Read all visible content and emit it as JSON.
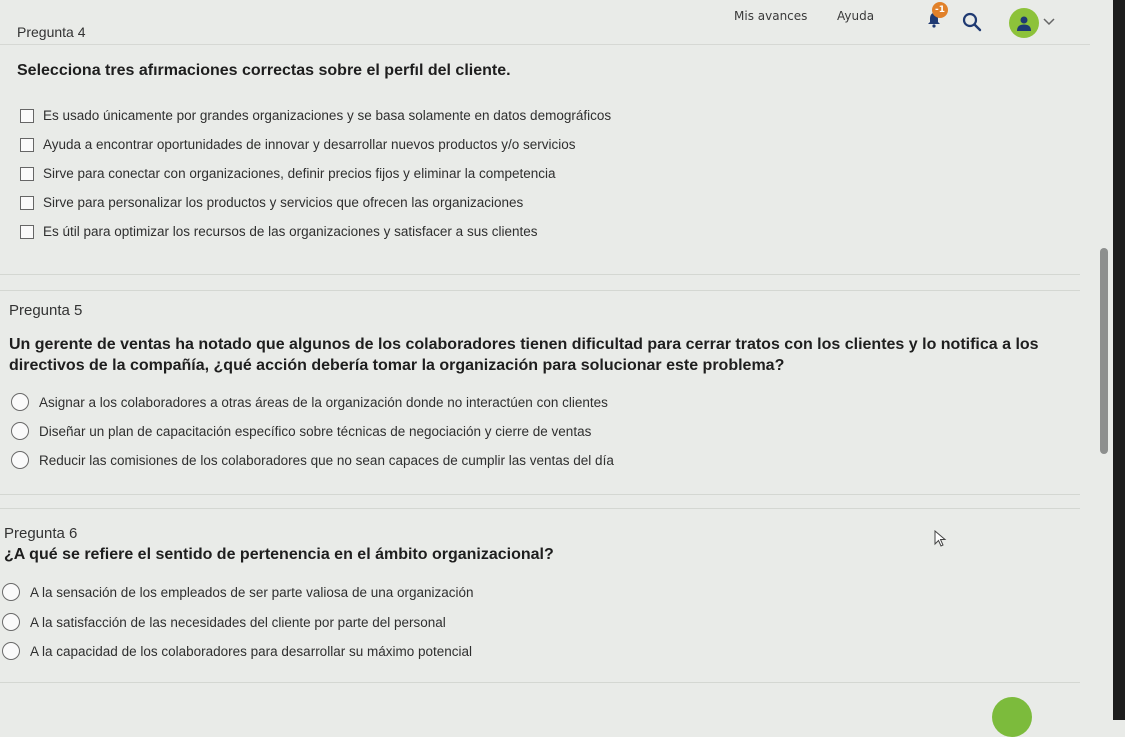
{
  "header": {
    "nav": [
      {
        "label": "Mis avances"
      },
      {
        "label": "Ayuda"
      }
    ],
    "notification_count": "-1",
    "icons": [
      "bell-icon",
      "search-icon",
      "user-avatar-icon",
      "chevron-down-icon"
    ]
  },
  "top_label": "Pregunta 4",
  "q4": {
    "text": "Selecciona tres afırmaciones correctas sobre el perfıl del cliente.",
    "type": "checkbox",
    "options": [
      {
        "label": "Es usado únicamente por grandes organizaciones y se basa solamente en datos demográficos"
      },
      {
        "label": "Ayuda a encontrar oportunidades de innovar y desarrollar nuevos productos y/o servicios"
      },
      {
        "label": "Sirve para conectar con organizaciones, definir precios fijos y eliminar la competencia"
      },
      {
        "label": "Sirve para personalizar los productos y servicios que ofrecen las organizaciones"
      },
      {
        "label": "Es útil para optimizar los recursos de las organizaciones y satisfacer a sus clientes"
      }
    ]
  },
  "q5": {
    "title": "Pregunta 5",
    "text_line1": "Un gerente de ventas ha notado que algunos de los colaboradores tienen dificultad para cerrar tratos con los clientes y lo notifica a los",
    "text_line2": "directivos de la compañía, ¿qué acción debería tomar la organización para solucionar este problema?",
    "type": "radio",
    "options": [
      {
        "label": "Asignar a los colaboradores a otras áreas de la organización donde no interactúen con clientes"
      },
      {
        "label": "Diseñar un plan de capacitación específico sobre técnicas de negociación y cierre de ventas"
      },
      {
        "label": "Reducir las comisiones de los colaboradores que no sean capaces de cumplir las ventas del día"
      }
    ]
  },
  "q6": {
    "title": "Pregunta 6",
    "text": "¿A qué se refiere el sentido de pertenencia en el ámbito organizacional?",
    "type": "radio",
    "options": [
      {
        "label": "A la sensación de los empleados de ser parte valiosa de una organización"
      },
      {
        "label": "A la satisfacción de las necesidades del cliente por parte del personal"
      },
      {
        "label": "A la capacidad de los colaboradores para desarrollar su máximo potencial"
      }
    ]
  },
  "colors": {
    "accent_green": "#8dc23a",
    "badge_orange": "#e1812a",
    "background": "#e9ebe8"
  }
}
